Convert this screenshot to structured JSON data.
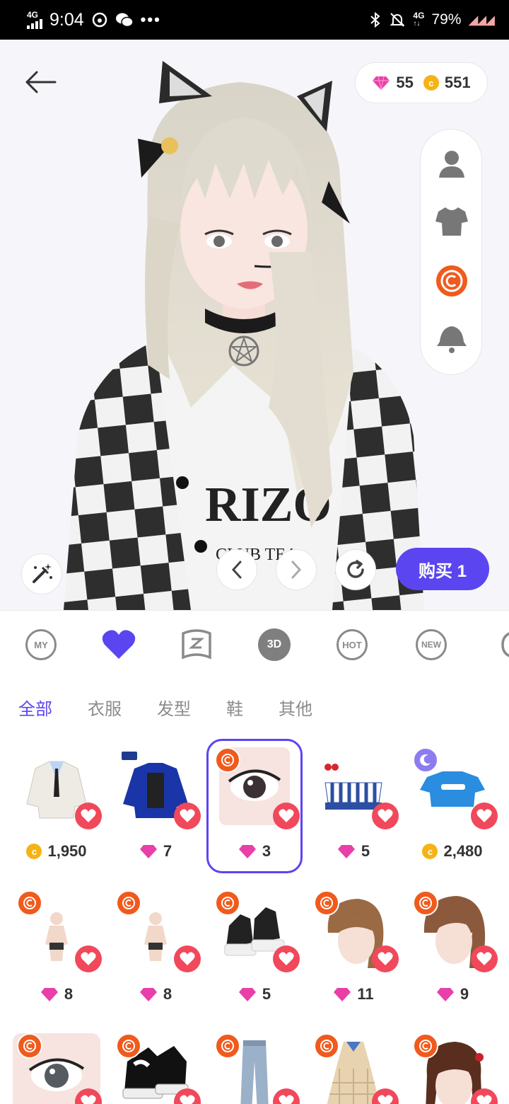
{
  "status_bar": {
    "network": "4G",
    "time": "9:04",
    "more": "•••",
    "network_right": "4G",
    "battery": "79%"
  },
  "header": {
    "gems": "55",
    "coins": "551"
  },
  "side_panel": {
    "items": [
      "avatar-icon",
      "shirt-icon",
      "coin-filter-icon",
      "bell-icon"
    ]
  },
  "controls": {
    "buy_label": "购买 1"
  },
  "categories": [
    "MY",
    "favorites",
    "wardrobe",
    "3D",
    "HOT",
    "NEW",
    "more"
  ],
  "tabs": {
    "all": "全部",
    "clothes": "衣服",
    "hair": "发型",
    "shoes": "鞋",
    "other": "其他"
  },
  "items": [
    {
      "price": "1,950",
      "currency": "coin",
      "desc": "sweater"
    },
    {
      "price": "7",
      "currency": "gem",
      "desc": "jacket"
    },
    {
      "price": "3",
      "currency": "gem",
      "desc": "eyes",
      "selected": true
    },
    {
      "price": "5",
      "currency": "gem",
      "desc": "top"
    },
    {
      "price": "2,480",
      "currency": "coin",
      "desc": "tee"
    },
    {
      "price": "8",
      "currency": "gem",
      "desc": "figure"
    },
    {
      "price": "8",
      "currency": "gem",
      "desc": "figure"
    },
    {
      "price": "5",
      "currency": "gem",
      "desc": "sneakers"
    },
    {
      "price": "11",
      "currency": "gem",
      "desc": "hair"
    },
    {
      "price": "9",
      "currency": "gem",
      "desc": "hair"
    }
  ],
  "colors": {
    "accent": "#5b45f0",
    "heart": "#f1485b",
    "badge": "#f05a1c",
    "gem": "#e83fa8",
    "coin": "#f5b316"
  }
}
